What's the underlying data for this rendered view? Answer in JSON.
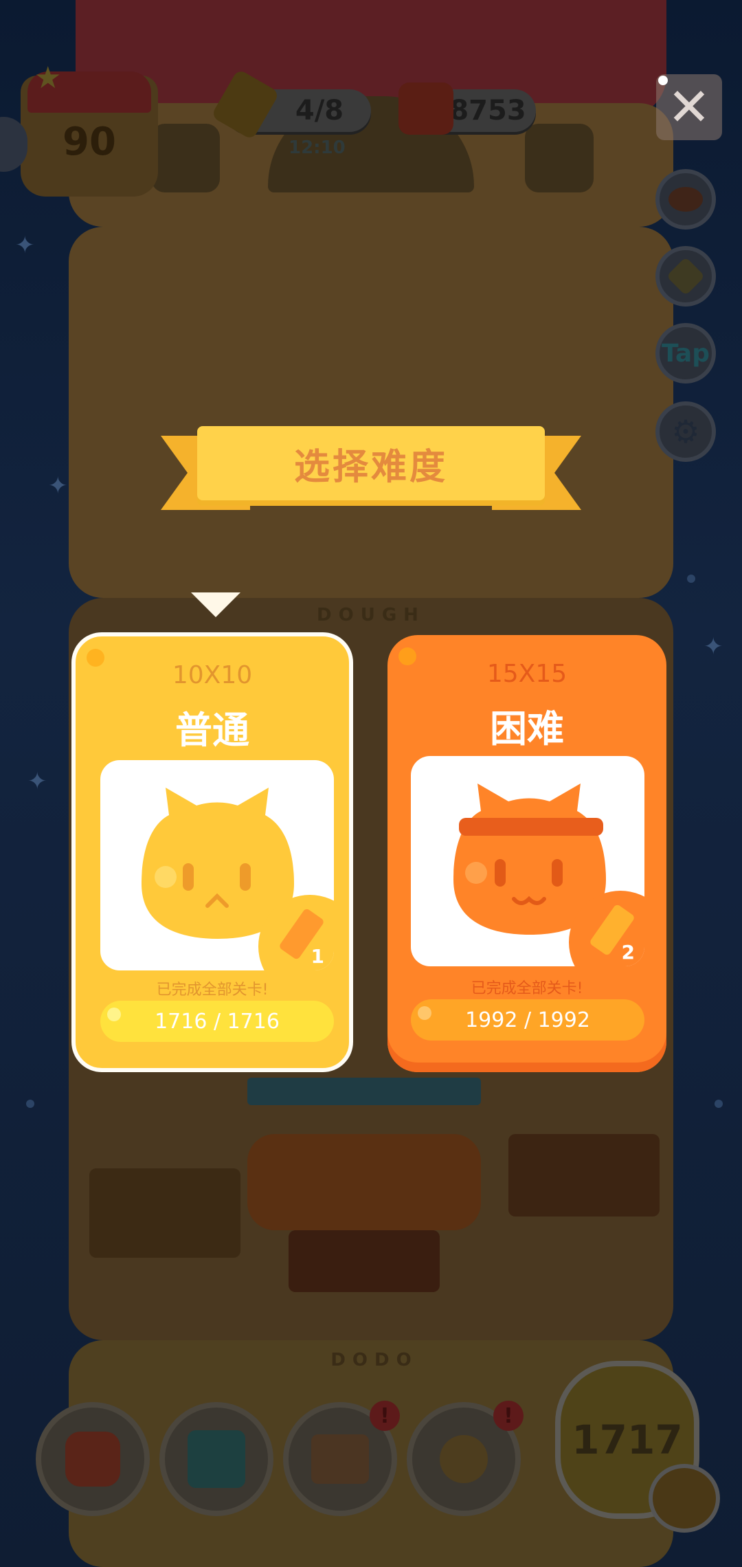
{
  "hud": {
    "house_level": "90",
    "pencils": "4/8",
    "pencil_timer": "12:10",
    "coins": "8753"
  },
  "side_buttons": {
    "tap_label": "Tap"
  },
  "scene_labels": {
    "floor1": "DOUGH",
    "floor2": "DODO"
  },
  "bottom": {
    "level_count": "1717"
  },
  "dialog": {
    "title": "选择难度",
    "cards": [
      {
        "size": "10X10",
        "name": "普通",
        "pencil_cost": "1",
        "completed_text": "已完成全部关卡!",
        "progress_text": "1716 / 1716",
        "progress_fraction": 1.0,
        "color": "#ffc93a",
        "selected": true
      },
      {
        "size": "15X15",
        "name": "困难",
        "pencil_cost": "2",
        "completed_text": "已完成全部关卡!",
        "progress_text": "1992 / 1992",
        "progress_fraction": 1.0,
        "color": "#ff8428",
        "selected": false
      }
    ]
  },
  "colors": {
    "accent_yellow": "#ffc93a",
    "accent_orange": "#ff8428",
    "ribbon": "#ffd24a",
    "ribbon_text": "#e48a3e"
  }
}
